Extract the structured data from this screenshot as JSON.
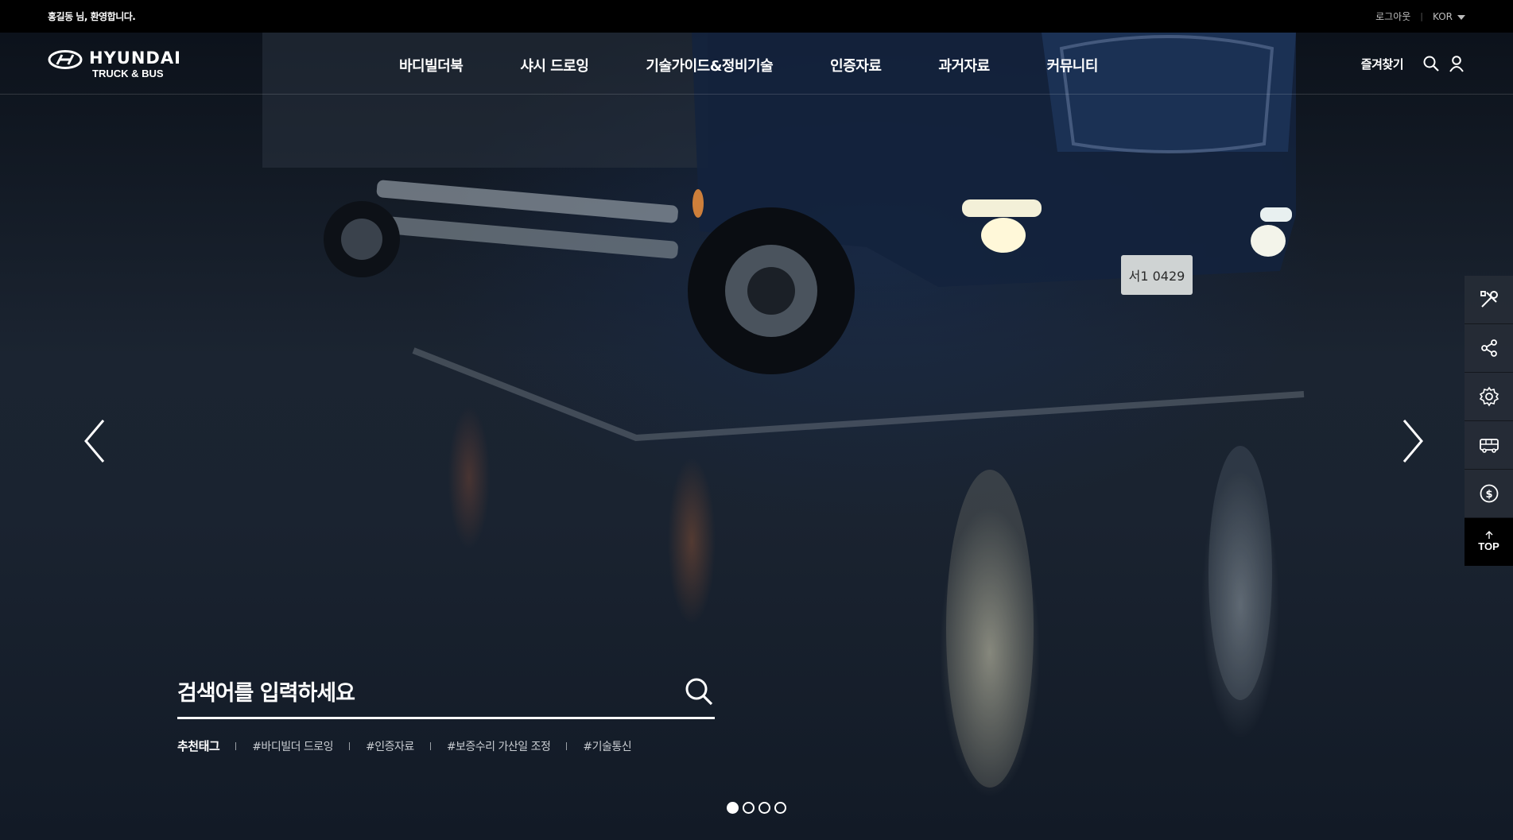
{
  "topbar": {
    "welcome": "홍길동 님, 환영합니다.",
    "logout": "로그아웃",
    "language": "KOR"
  },
  "header": {
    "logo": {
      "brand": "HYUNDAI",
      "sub": "TRUCK & BUS"
    },
    "nav": [
      "바디빌더북",
      "샤시 드로잉",
      "기술가이드&정비기술",
      "인증자료",
      "과거자료",
      "커뮤니티"
    ],
    "favorites": "즐겨찾기"
  },
  "search": {
    "placeholder": "검색어를 입력하세요",
    "tags_label": "추천태그",
    "tags": [
      "#바디빌더 드로잉",
      "#인증자료",
      "#보증수리 가산일 조정",
      "#기술통신"
    ]
  },
  "hero": {
    "plate": "서1 0429"
  },
  "quick_menu": {
    "icons": [
      "tools-icon",
      "share-icon",
      "settings-icon",
      "bus-icon",
      "coin-icon"
    ],
    "top_label": "TOP"
  },
  "slider": {
    "total": 4,
    "active": 1
  },
  "colors": {
    "topbar": "#000000",
    "quickmenu": "#262c36"
  }
}
